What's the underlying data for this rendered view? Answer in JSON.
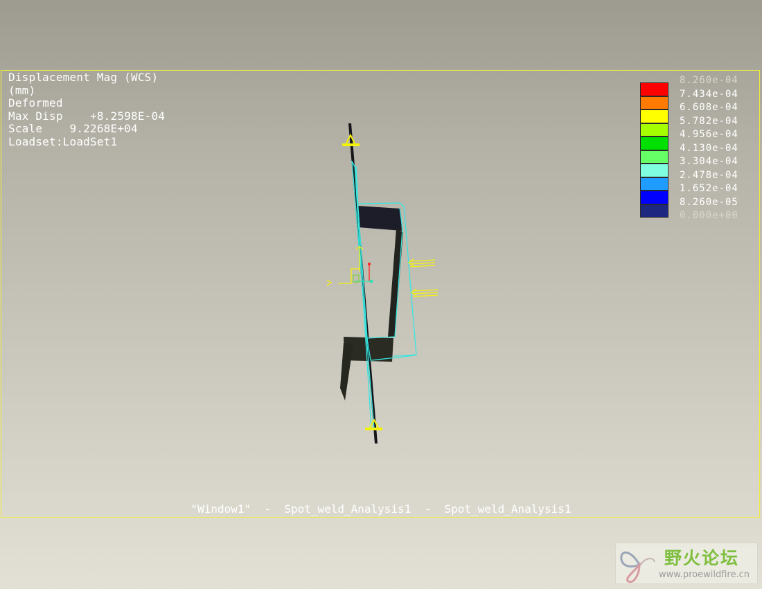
{
  "info": {
    "result_type": "Displacement Mag (WCS)",
    "units": "(mm)",
    "display_mode": "Deformed",
    "max_disp": "Max Disp    +8.2598E-04",
    "scale": "Scale    9.2268E+04",
    "loadset": "Loadset:LoadSet1"
  },
  "legend": {
    "labels": [
      "8.260e-04",
      "7.434e-04",
      "6.608e-04",
      "5.782e-04",
      "4.956e-04",
      "4.130e-04",
      "3.304e-04",
      "2.478e-04",
      "1.652e-04",
      "8.260e-05",
      "0.000e+00"
    ],
    "colors": [
      "#ff0000",
      "#ff7a00",
      "#ffff00",
      "#a6ff00",
      "#00e000",
      "#66ff66",
      "#80ffe0",
      "#1e9cff",
      "#0000ff",
      "#1e2780"
    ]
  },
  "caption": "\"Window1\"  -  Spot_weld_Analysis1  -  Spot_weld_Analysis1",
  "watermark": {
    "title": "野火论坛",
    "url": "www.proewildfire.cn"
  }
}
